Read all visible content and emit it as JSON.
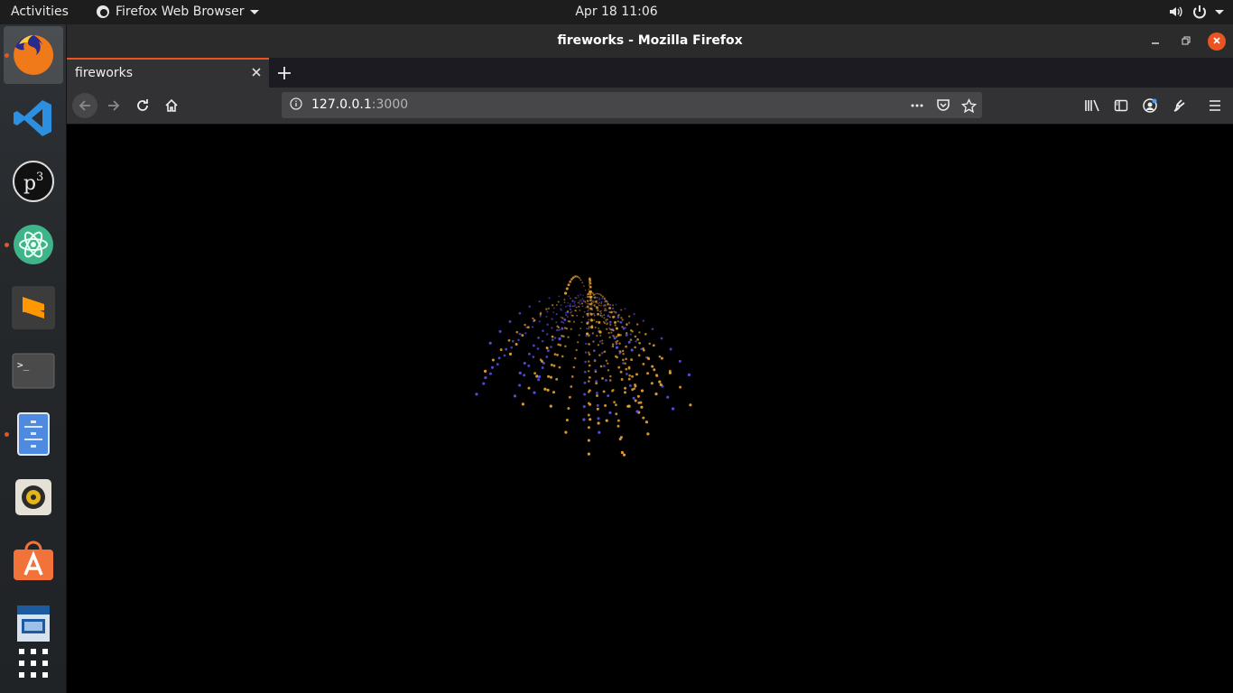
{
  "topbar": {
    "activities": "Activities",
    "app_menu": "Firefox Web Browser",
    "datetime": "Apr 18  11:06"
  },
  "dock": {
    "items": [
      {
        "name": "firefox",
        "running": true,
        "active": true
      },
      {
        "name": "vscode",
        "running": false
      },
      {
        "name": "p3",
        "running": false
      },
      {
        "name": "atom",
        "running": true
      },
      {
        "name": "sublime-text",
        "running": false
      },
      {
        "name": "terminal",
        "running": false
      },
      {
        "name": "files",
        "running": true
      },
      {
        "name": "rhythmbox",
        "running": false
      },
      {
        "name": "software",
        "running": false
      },
      {
        "name": "impress",
        "running": false
      },
      {
        "name": "show-apps",
        "running": false
      }
    ]
  },
  "window": {
    "title": "fireworks - Mozilla Firefox"
  },
  "browser": {
    "tab_title": "fireworks",
    "url_host": "127.0.0.1",
    "url_port": ":3000"
  },
  "colors": {
    "accent": "#e95420",
    "firework_orange": "#e8a030",
    "firework_blue": "#5a50e6"
  }
}
